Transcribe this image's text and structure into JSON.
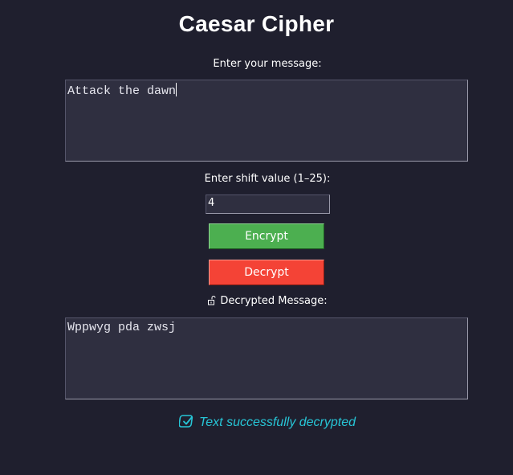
{
  "app": {
    "title": "Caesar Cipher"
  },
  "input": {
    "label": "Enter your message:",
    "value": "Attack the dawn"
  },
  "shift": {
    "label": "Enter shift value (1–25):",
    "value": "4"
  },
  "buttons": {
    "encrypt_label": "Encrypt",
    "decrypt_label": "Decrypt"
  },
  "output": {
    "label": "Decrypted Message:",
    "icon": "unlock-icon",
    "value": "Wppwyg pda zwsj"
  },
  "status": {
    "icon": "check-icon",
    "text": "Text successfully decrypted"
  },
  "colors": {
    "background": "#1f1f2e",
    "encrypt": "#4caf50",
    "decrypt": "#f44336",
    "status": "#27c5d6"
  }
}
